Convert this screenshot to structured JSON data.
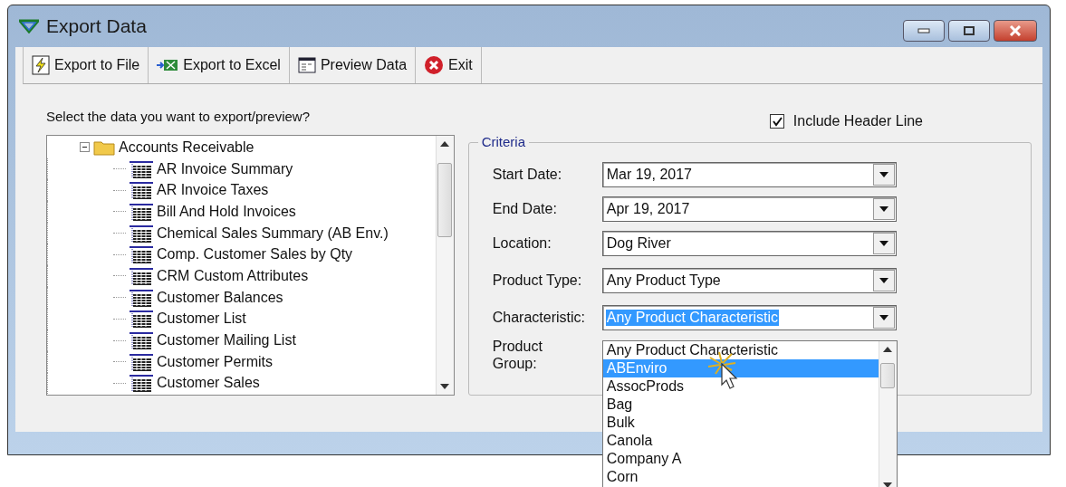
{
  "window": {
    "title": "Export Data"
  },
  "toolbar": [
    {
      "label": "Export to File",
      "kind": "file"
    },
    {
      "label": "Export to Excel",
      "kind": "excel"
    },
    {
      "label": "Preview Data",
      "kind": "preview"
    },
    {
      "label": "Exit",
      "kind": "exit"
    }
  ],
  "prompt": "Select the data you want to export/preview?",
  "include_header_line": {
    "label": "Include Header Line",
    "checked": true
  },
  "tree": [
    {
      "label": "Accounts Receivable",
      "expanded": true,
      "children": [
        {
          "label": "AR Invoice Summary"
        },
        {
          "label": "AR Invoice Taxes"
        },
        {
          "label": "Bill And Hold Invoices"
        },
        {
          "label": "Chemical Sales Summary (AB Env.)"
        },
        {
          "label": "Comp. Customer Sales by Qty"
        },
        {
          "label": "CRM Custom Attributes"
        },
        {
          "label": "Customer Balances"
        },
        {
          "label": "Customer List"
        },
        {
          "label": "Customer Mailing List"
        },
        {
          "label": "Customer Permits"
        },
        {
          "label": "Customer Sales"
        }
      ]
    }
  ],
  "criteria": {
    "title": "Criteria",
    "fields": [
      {
        "label": "Start Date:",
        "kind": "date",
        "value": "Mar 19, 2017",
        "highlighted": false
      },
      {
        "label": "End Date:",
        "kind": "date",
        "value": "Apr 19, 2017",
        "highlighted": false
      },
      {
        "label": "Location:",
        "kind": "combo",
        "value": "Dog River",
        "highlighted": false
      },
      {
        "label": "Product Type:",
        "kind": "combo",
        "value": "Any Product Type",
        "highlighted": false
      },
      {
        "label": "Characteristic:",
        "kind": "combo",
        "value": "Any Product Characteristic",
        "highlighted": true
      },
      {
        "label": "Product Group:",
        "kind": "covered"
      }
    ]
  },
  "dropdown": [
    {
      "label": "Any Product Characteristic",
      "selected": false
    },
    {
      "label": "ABEnviro",
      "selected": true
    },
    {
      "label": "AssocProds",
      "selected": false
    },
    {
      "label": "Bag",
      "selected": false
    },
    {
      "label": "Bulk",
      "selected": false
    },
    {
      "label": "Canola",
      "selected": false
    },
    {
      "label": "Company A",
      "selected": false
    },
    {
      "label": "Corn",
      "selected": false
    }
  ]
}
